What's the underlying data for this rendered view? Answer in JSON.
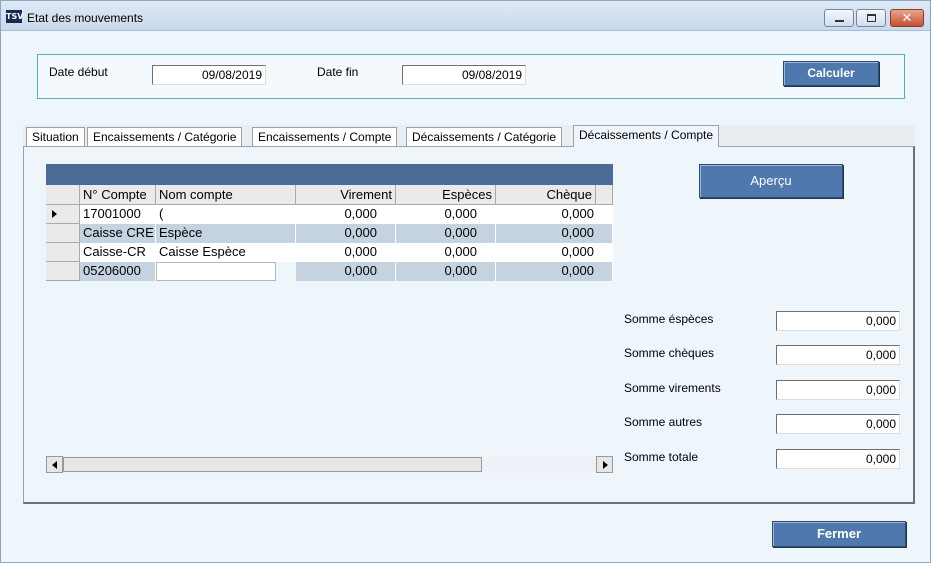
{
  "window": {
    "title": "Etat des mouvements",
    "icon_text": "TSV",
    "icons": {
      "minimize": "minimize-icon",
      "maximize": "maximize-icon",
      "close": "close-icon"
    },
    "close_glyph": "✕"
  },
  "dates": {
    "start_label": "Date début",
    "start_value": "09/08/2019",
    "end_label": "Date fin",
    "end_value": "09/08/2019",
    "calculate_label": "Calculer"
  },
  "tabs": [
    {
      "label": "Situation",
      "active": false
    },
    {
      "label": "Encaissements / Catégorie",
      "active": false
    },
    {
      "label": "Encaissements / Compte",
      "active": false
    },
    {
      "label": "Décaissements / Catégorie",
      "active": false
    },
    {
      "label": "Décaissements / Compte",
      "active": true
    }
  ],
  "grid": {
    "columns": [
      "N° Compte",
      "Nom compte",
      "Virement",
      "Espèces",
      "Chèque"
    ],
    "rows": [
      {
        "compte": "17001000",
        "nom": "(",
        "virement": "0,000",
        "especes": "0,000",
        "cheque": "0,000",
        "current": true
      },
      {
        "compte": "Caisse CRE",
        "nom": "Espèce",
        "virement": "0,000",
        "especes": "0,000",
        "cheque": "0,000",
        "current": false
      },
      {
        "compte": "Caisse-CR",
        "nom": "Caisse Espèce",
        "virement": "0,000",
        "especes": "0,000",
        "cheque": "0,000",
        "current": false
      },
      {
        "compte": "05206000",
        "nom": "",
        "virement": "0,000",
        "especes": "0,000",
        "cheque": "0,000",
        "current": false
      }
    ]
  },
  "preview_label": "Aperçu",
  "sums": {
    "especes_label": "Somme éspèces",
    "especes_value": "0,000",
    "cheques_label": "Somme chèques",
    "cheques_value": "0,000",
    "virements_label": "Somme virements",
    "virements_value": "0,000",
    "autres_label": "Somme autres",
    "autres_value": "0,000",
    "totale_label": "Somme totale",
    "totale_value": "0,000"
  },
  "close_label": "Fermer"
}
